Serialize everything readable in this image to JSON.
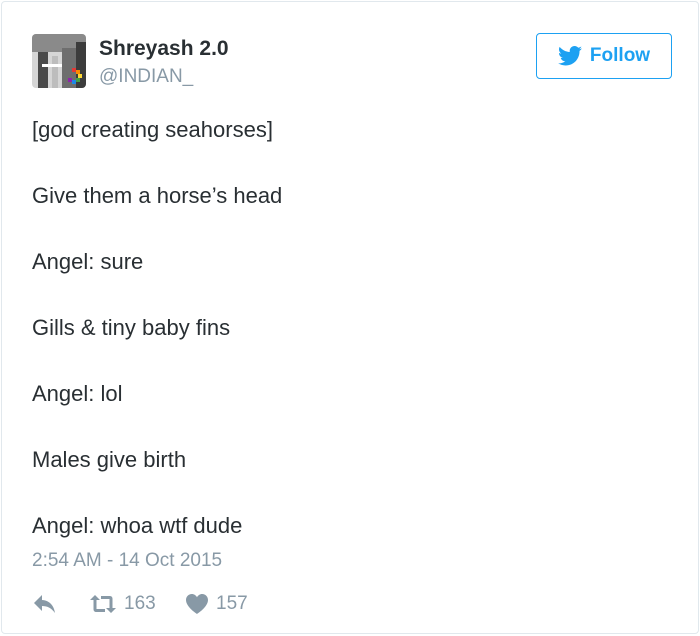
{
  "user": {
    "display_name": "Shreyash 2.0",
    "handle": "@INDIAN_",
    "avatar_icon": "profile-photo-icon"
  },
  "follow": {
    "label": "Follow",
    "icon": "twitter-bird-icon",
    "color": "#1da1f2"
  },
  "tweet": {
    "lines": [
      "[god creating seahorses]",
      "Give them a horse’s head",
      "Angel: sure",
      "Gills & tiny baby fins",
      "Angel: lol",
      "Males give birth",
      "Angel: whoa wtf dude"
    ],
    "timestamp": "2:54 AM - 14 Oct 2015"
  },
  "actions": {
    "reply_icon": "reply-icon",
    "retweet_icon": "retweet-icon",
    "retweet_count": "163",
    "like_icon": "heart-icon",
    "like_count": "157"
  },
  "colors": {
    "text": "#292f33",
    "muted": "#8899a6",
    "border": "#e1e8ed"
  }
}
